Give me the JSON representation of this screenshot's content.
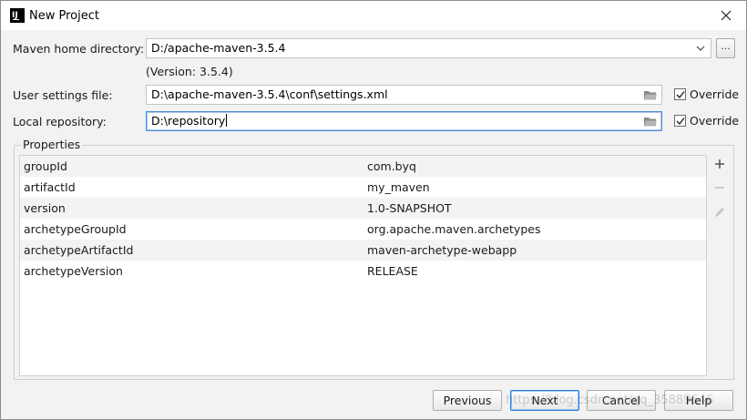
{
  "window": {
    "title": "New Project",
    "app_icon_letter": "IJ"
  },
  "form": {
    "maven_home_label": "Maven home directory:",
    "maven_home_value": "D:/apache-maven-3.5.4",
    "version_note": "(Version: 3.5.4)",
    "user_settings_label": "User settings file:",
    "user_settings_value": "D:\\apache-maven-3.5.4\\conf\\settings.xml",
    "user_settings_override_label": "Override",
    "user_settings_override_checked": true,
    "local_repo_label": "Local repository:",
    "local_repo_value": "D:\\repository",
    "local_repo_override_label": "Override",
    "local_repo_override_checked": true,
    "browse_label": "..."
  },
  "properties": {
    "title": "Properties",
    "rows": [
      {
        "key": "groupId",
        "value": "com.byq"
      },
      {
        "key": "artifactId",
        "value": "my_maven"
      },
      {
        "key": "version",
        "value": "1.0-SNAPSHOT"
      },
      {
        "key": "archetypeGroupId",
        "value": "org.apache.maven.archetypes"
      },
      {
        "key": "archetypeArtifactId",
        "value": "maven-archetype-webapp"
      },
      {
        "key": "archetypeVersion",
        "value": "RELEASE"
      }
    ],
    "tools": [
      "add-icon",
      "remove-icon",
      "edit-icon"
    ]
  },
  "buttons": {
    "previous": "Previous",
    "next": "Next",
    "cancel": "Cancel",
    "help": "Help"
  },
  "watermark": "https://blog.csdn.net/qq_35889646"
}
